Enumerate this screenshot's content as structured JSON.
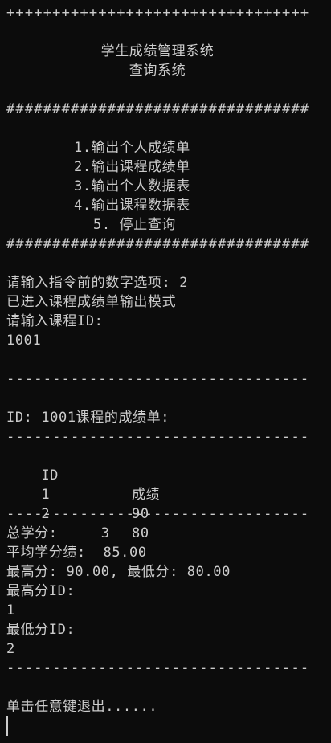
{
  "header": {
    "plus_border": "+++++++++++++++++++++++++++++++++",
    "title": "学生成绩管理系统",
    "subtitle": "查询系统",
    "hash_border": "#################################"
  },
  "menu": {
    "items": [
      "1.输出个人成绩单",
      "2.输出课程成绩单",
      "3.输出个人数据表",
      "4.输出课程数据表",
      "5. 停止查询"
    ]
  },
  "session": {
    "prompt_option": "请输入指令前的数字选项: 2",
    "mode_message": "已进入课程成绩单输出模式",
    "prompt_course_id": "请输入课程ID:",
    "entered_course_id": "1001"
  },
  "report": {
    "dash_line": "---------------------------------",
    "heading": "ID: 1001课程的成绩单:",
    "col_id": "ID",
    "col_score": "成绩",
    "rows": [
      {
        "id": "1",
        "score": "90"
      },
      {
        "id": "2",
        "score": "80"
      }
    ],
    "total_credit": "总学分:     3",
    "avg_score": "平均学分绩:  85.00",
    "max_min": "最高分: 90.00, 最低分: 80.00",
    "max_id_label": "最高分ID:",
    "max_id_value": "1",
    "min_id_label": "最低分ID:",
    "min_id_value": "2"
  },
  "footer": {
    "exit_prompt": "单击任意键退出......"
  }
}
